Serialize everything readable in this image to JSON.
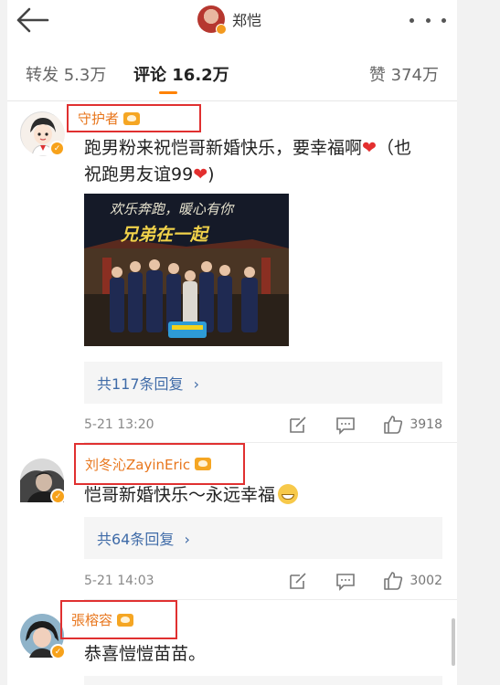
{
  "header": {
    "user_name": "郑恺",
    "back_icon": "back-arrow-icon",
    "more_icon": "more-dots-icon"
  },
  "tabs": [
    {
      "label": "转发 5.3万"
    },
    {
      "label": "评论 16.2万",
      "active": true
    },
    {
      "label": "赞 374万"
    }
  ],
  "colors": {
    "accent": "#ff8200",
    "username": "#e8761c",
    "link": "#3f6ba8",
    "highlight_box": "#e03030",
    "verified": "#f7a21b"
  },
  "comments": [
    {
      "user": "守护者",
      "text_a": "跑男粉来祝恺哥新婚快乐，要幸福啊",
      "text_b": "（也",
      "text_c": "祝跑男友谊99",
      "photo_title_1": "欢乐奔跑，暖心有你",
      "photo_title_2": "兄弟在一起",
      "replies": "共117条回复",
      "time": "5-21 13:20",
      "likes": "3918"
    },
    {
      "user": "刘冬沁ZayinEric",
      "text_a": "恺哥新婚快乐～永远幸福",
      "replies": "共64条回复",
      "time": "5-21 14:03",
      "likes": "3002"
    },
    {
      "user": "張榕容",
      "text_a": "恭喜愷愷苗苗。"
    }
  ]
}
